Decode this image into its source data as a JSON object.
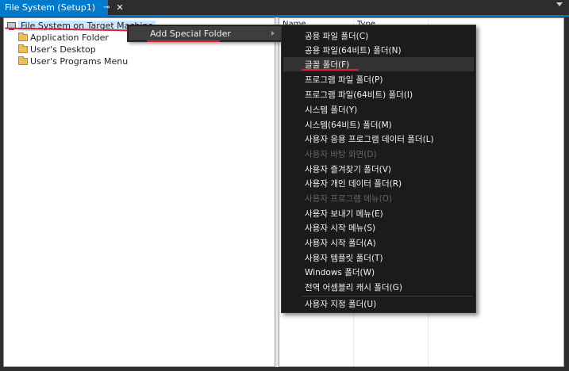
{
  "tab": {
    "title": "File System (Setup1)",
    "pin_glyph": "⊸",
    "close_glyph": "✕"
  },
  "columns": {
    "name": "Name",
    "type": "Type"
  },
  "tree": {
    "root": "File System on Target Machine",
    "items": [
      "Application Folder",
      "User's Desktop",
      "User's Programs Menu"
    ]
  },
  "context_menu": {
    "item": "Add Special Folder"
  },
  "submenu": {
    "items": [
      {
        "label": "공용 파일 폴더(C)",
        "enabled": true
      },
      {
        "label": "공용 파일(64비트) 폴더(N)",
        "enabled": true
      },
      {
        "label": "글꼴 폴더(F)",
        "enabled": true,
        "highlighted": true
      },
      {
        "label": "프로그램 파일 폴더(P)",
        "enabled": true
      },
      {
        "label": "프로그램 파일(64비트) 폴더(I)",
        "enabled": true
      },
      {
        "label": "시스템 폴더(Y)",
        "enabled": true
      },
      {
        "label": "시스템(64비트) 폴더(M)",
        "enabled": true
      },
      {
        "label": "사용자 응용 프로그램 데이터 폴더(L)",
        "enabled": true
      },
      {
        "label": "사용자 바탕 화면(D)",
        "enabled": false
      },
      {
        "label": "사용자 즐겨찾기 폴더(V)",
        "enabled": true
      },
      {
        "label": "사용자 개인 데이터 폴더(R)",
        "enabled": true
      },
      {
        "label": "사용자 프로그램 메뉴(O)",
        "enabled": false
      },
      {
        "label": "사용자 보내기 메뉴(E)",
        "enabled": true
      },
      {
        "label": "사용자 시작 메뉴(S)",
        "enabled": true
      },
      {
        "label": "사용자 시작 폴더(A)",
        "enabled": true
      },
      {
        "label": "사용자 템플릿 폴더(T)",
        "enabled": true
      },
      {
        "label": "Windows 폴더(W)",
        "enabled": true
      },
      {
        "label": "전역 어셈블리 캐시 폴더(G)",
        "enabled": true
      },
      {
        "label": "사용자 지정 폴더(U)",
        "enabled": true
      }
    ]
  },
  "colors": {
    "accent": "#007acc",
    "annotation": "#e0202a",
    "menu_bg": "#1b1b1c",
    "disabled_text": "#656565"
  }
}
